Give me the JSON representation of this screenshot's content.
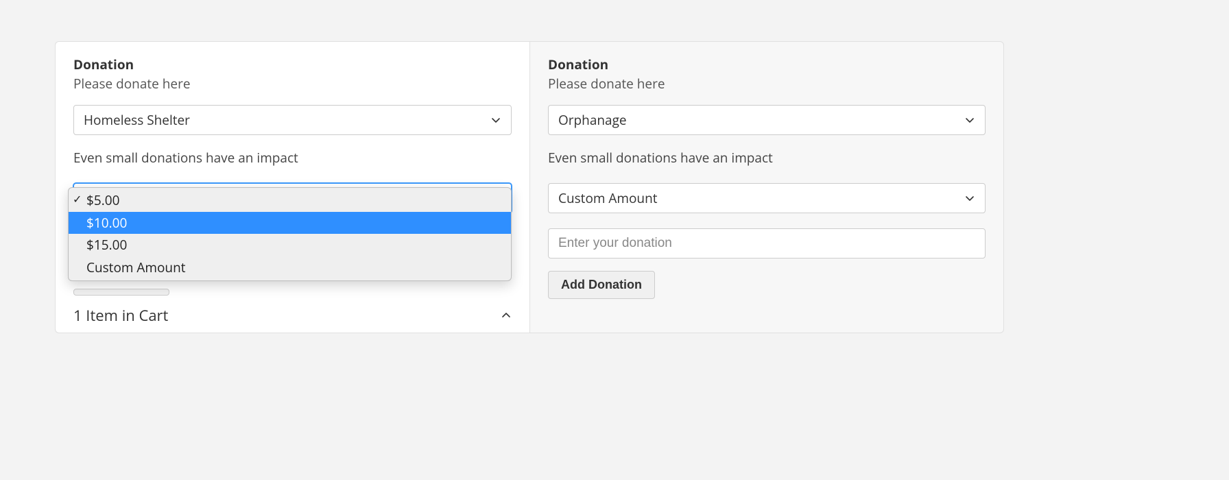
{
  "left": {
    "title": "Donation",
    "subtitle": "Please donate here",
    "recipient_selected": "Homeless Shelter",
    "impact_text": "Even small donations have an impact",
    "amount_selected": "$5.00",
    "amount_options": [
      {
        "label": "$5.00",
        "checked": true,
        "highlight": false
      },
      {
        "label": "$10.00",
        "checked": false,
        "highlight": true
      },
      {
        "label": "$15.00",
        "checked": false,
        "highlight": false
      },
      {
        "label": "Custom Amount",
        "checked": false,
        "highlight": false
      }
    ],
    "cart_summary": "1 Item in Cart"
  },
  "right": {
    "title": "Donation",
    "subtitle": "Please donate here",
    "recipient_selected": "Orphanage",
    "impact_text": "Even small donations have an impact",
    "amount_selected": "Custom Amount",
    "custom_amount_placeholder": "Enter your donation",
    "add_button": "Add Donation"
  }
}
